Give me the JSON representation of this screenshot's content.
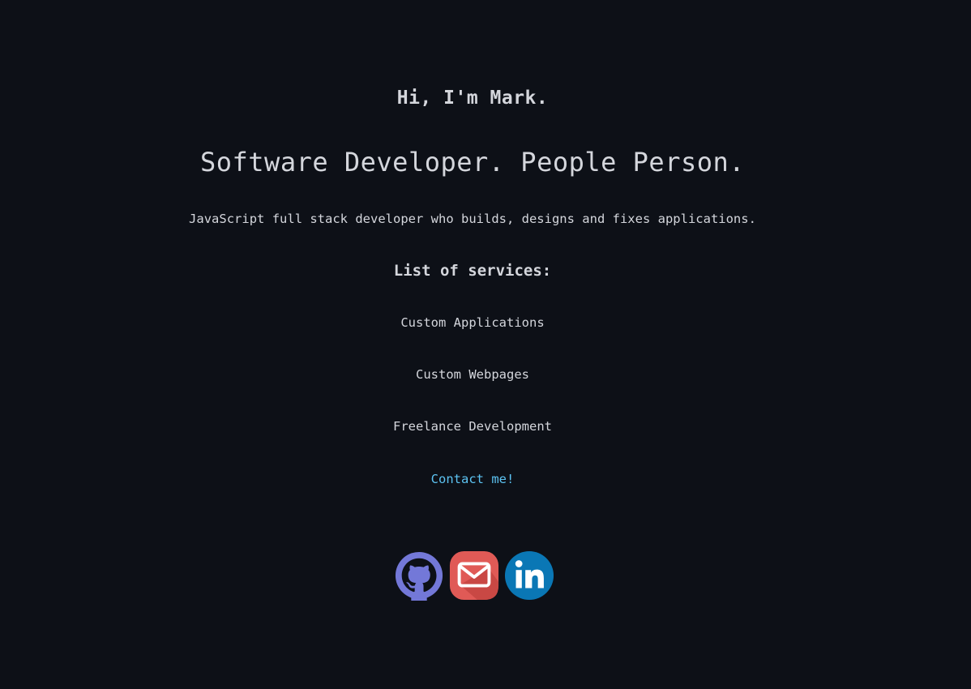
{
  "hero": {
    "greeting": "Hi, I'm Mark.",
    "tagline": "Software Developer. People Person.",
    "intro": "JavaScript full stack developer who builds, designs and fixes applications."
  },
  "services": {
    "heading": "List of services:",
    "items": [
      "Custom Applications",
      "Custom Webpages",
      "Freelance Development"
    ]
  },
  "contact": {
    "label": "Contact me!"
  },
  "socials": [
    {
      "icon": "github-icon",
      "color": "#7378d8"
    },
    {
      "icon": "email-icon",
      "color": "#e05a56"
    },
    {
      "icon": "linkedin-icon",
      "color": "#0a77b5"
    }
  ],
  "colors": {
    "background": "#0d1017",
    "text": "#d4d6dc",
    "link": "#5cc3f2"
  }
}
